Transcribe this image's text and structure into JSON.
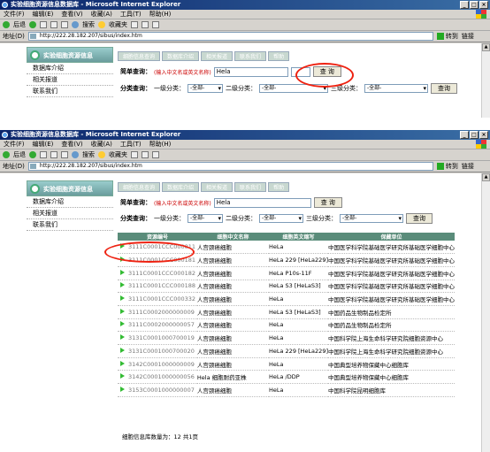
{
  "window": {
    "title": "实验细胞资源信息数据库 - Microsoft Internet Explorer",
    "controls": [
      "_",
      "□",
      "×"
    ]
  },
  "menu": [
    "文件(F)",
    "编辑(E)",
    "查看(V)",
    "收藏(A)",
    "工具(T)",
    "帮助(H)"
  ],
  "toolbar": {
    "back": "后退",
    "search": "搜索",
    "favorites": "收藏夹"
  },
  "address": {
    "label": "地址(D)",
    "url": "http://222.28.182.207/sibus/index.htm",
    "go": "转到",
    "links": "链接"
  },
  "sidebar": {
    "title": "实验细胞资源信息",
    "items": [
      "数据库介绍",
      "相关报道",
      "联系我们"
    ]
  },
  "tabs": [
    "细胞信息查询",
    "数据库介绍",
    "相关报道",
    "联系我们",
    "帮助"
  ],
  "search": {
    "simple_label": "简单查询：",
    "hint": "(输入中文名或英文名称)",
    "value": "Hela",
    "button": "查 询",
    "category_label": "分类查询：",
    "level1_label": "一级分类：",
    "level2_label": "二级分类：",
    "level3_label": "三级分类：",
    "option_all": "-全部-",
    "category_button": "查询"
  },
  "table": {
    "headers": [
      "资源编号",
      "细胞中文名称",
      "细胞英文缩写",
      "保藏单位"
    ],
    "rows": [
      [
        "3111C0001CCC000011",
        "人宫颈癌细胞",
        "HeLa",
        "中国医学科学院基础医学研究所基础医学细胞中心"
      ],
      [
        "3111C0001CCC000181",
        "人宫颈癌细胞",
        "HeLa 229 [HeLa229]",
        "中国医学科学院基础医学研究所基础医学细胞中心"
      ],
      [
        "3111C0001CCC000182",
        "人宫颈癌细胞",
        "HeLa P10s-11F",
        "中国医学科学院基础医学研究所基础医学细胞中心"
      ],
      [
        "3111C0001CCC000188",
        "人宫颈癌细胞",
        "HeLa S3 [HeLaS3]",
        "中国医学科学院基础医学研究所基础医学细胞中心"
      ],
      [
        "3111C0001CCC000332",
        "人宫颈癌细胞",
        "HeLa",
        "中国医学科学院基础医学研究所基础医学细胞中心"
      ],
      [
        "3111C0002000000009",
        "人宫颈癌细胞",
        "HeLa S3 [HeLaS3]",
        "中国药品生物制品检定所"
      ],
      [
        "3111C0002000000057",
        "人宫颈癌细胞",
        "HeLa",
        "中国药品生物制品检定所"
      ],
      [
        "3131C0001000700019",
        "人宫颈癌细胞",
        "HeLa",
        "中国科学院上海生命科学研究院细胞资源中心"
      ],
      [
        "3131C0001000700020",
        "人宫颈癌细胞",
        "HeLa 229 [HeLa229]",
        "中国科学院上海生命科学研究院细胞资源中心"
      ],
      [
        "3142C0001000000009",
        "人宫颈癌细胞",
        "HeLa",
        "中国典型培养物保藏中心细胞库"
      ],
      [
        "3142C0001000000056",
        "Hela 细胞耐药亚株",
        "HeLa /DDP",
        "中国典型培养物保藏中心细胞库"
      ],
      [
        "3153C0001000000007",
        "人宫颈癌细胞",
        "HeLa",
        "中国科学院昆明细胞库"
      ]
    ],
    "count": "细胞信息库数量为：12 共1页"
  }
}
